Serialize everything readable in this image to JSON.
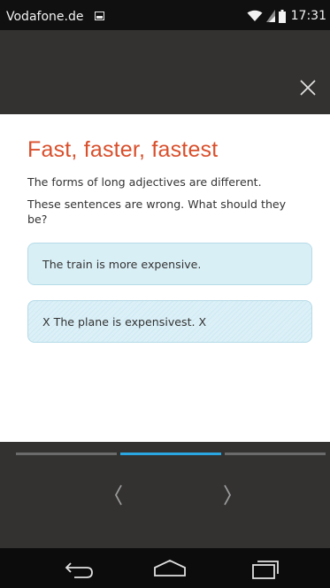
{
  "status_bar": {
    "carrier": "Vodafone.de",
    "time": "17:31",
    "icons": [
      "image-notification-icon",
      "wifi-icon",
      "signal-icon",
      "battery-icon"
    ]
  },
  "header": {
    "close_icon": "close-icon"
  },
  "exercise": {
    "title": "Fast, faster, fastest",
    "instruction_1": "The forms of long adjectives are different.",
    "instruction_2": "These sentences are wrong. What should they be?",
    "answers": [
      {
        "text": "The train is more expensive."
      },
      {
        "text": "X The plane is expensivest. X"
      }
    ]
  },
  "pager": {
    "page_count": 3,
    "current_page": 2,
    "prev_icon": "chevron-left-icon",
    "next_icon": "chevron-right-icon"
  },
  "system_nav": {
    "icons": [
      "back-icon",
      "home-icon",
      "recent-apps-icon"
    ]
  },
  "colors": {
    "accent_title": "#d94f2b",
    "progress_active": "#2aa6e0",
    "answer_bg": "#d9eff6",
    "header_bg": "#333231"
  }
}
